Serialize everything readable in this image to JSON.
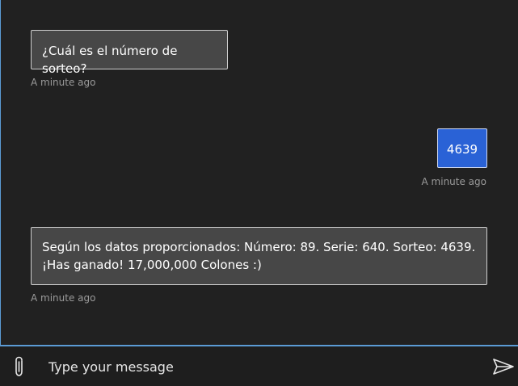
{
  "messages": [
    {
      "from": "bot",
      "text": "¿Cuál es el número de sorteo?",
      "timestamp": "A minute ago"
    },
    {
      "from": "user",
      "text": "4639",
      "timestamp": "A minute ago"
    },
    {
      "from": "bot",
      "text": "Según los datos proporcionados: Número: 89. Serie: 640. Sorteo: 4639. ¡Has ganado! 17,000,000 Colones :)",
      "timestamp": "A minute ago"
    }
  ],
  "composer": {
    "placeholder": "Type your message",
    "attach_icon": "paperclip-icon",
    "send_icon": "send-icon"
  },
  "colors": {
    "background": "#212121",
    "bot_bubble": "#474747",
    "user_bubble": "#2a62d6",
    "accent_border": "#5b9bd5"
  }
}
